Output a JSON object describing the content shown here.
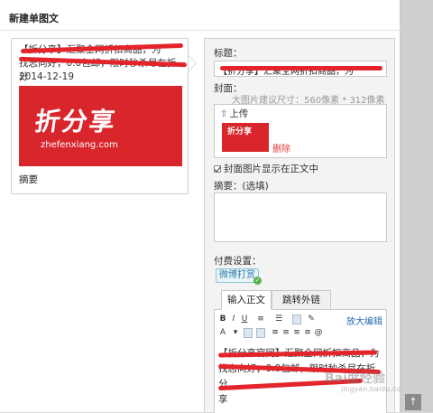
{
  "dialog": {
    "title": "新建单图文"
  },
  "preview": {
    "headline": "【折分享】汇聚全网折扣商品，为",
    "headline_line2": "找志向好，0.0包邮，限时秒杀尽在折分",
    "date": "2014-12-19",
    "cover_big_text": "折分享",
    "cover_small_text": "zhefenxiang.com",
    "summary_label": "摘要"
  },
  "form": {
    "title_label": "标题：",
    "title_value": "【折分享】汇聚全网折扣商品，为",
    "cover_label": "封面：",
    "cover_hint": "大图片建议尺寸：560像素 * 312像素",
    "upload_label": "上传",
    "cover_thumb_text": "折分享",
    "delete_label": "删除",
    "show_cover_label": "封面图片显示在正文中",
    "summary_label": "摘要：(选填)",
    "summary_value": "",
    "pay_label": "付费设置：",
    "pay_button": "微博打赏"
  },
  "editor": {
    "tabs": [
      {
        "label": "输入正文"
      },
      {
        "label": "跳转外链"
      }
    ],
    "zoom_label": "放大编辑",
    "body_line1": "【折分享官网】汇聚全网折扣商品，为",
    "body_line2": "找志向好，0.0包邮，限时秒杀尽在折分",
    "body_line3": "享"
  },
  "watermark": {
    "text": "Bai度经验",
    "sub": "jingyan.baidu.com"
  },
  "colors": {
    "redaction": "#e3242b",
    "link": "#2a6db5",
    "cover": "#d9262c"
  }
}
